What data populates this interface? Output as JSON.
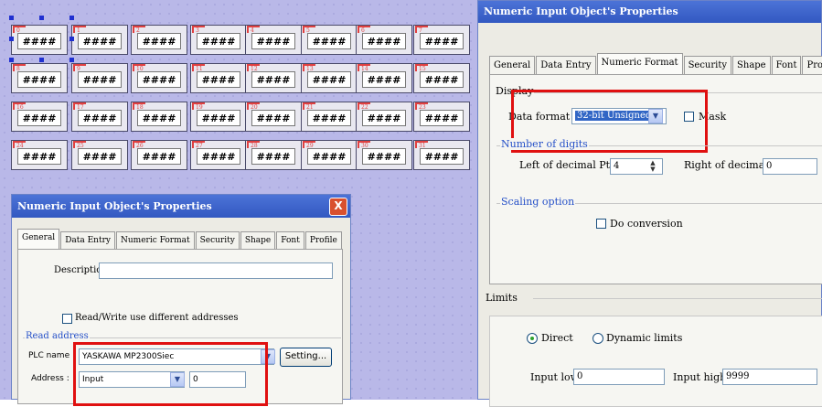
{
  "grid": {
    "placeholder": "####",
    "tags": [
      "0",
      "1",
      "2",
      "3",
      "4",
      "5",
      "6",
      "7",
      "8",
      "9",
      "10",
      "11",
      "12",
      "13",
      "14",
      "15",
      "16",
      "17",
      "18",
      "19",
      "20",
      "21",
      "22",
      "23",
      "24",
      "25",
      "26",
      "27",
      "28",
      "29",
      "30",
      "31"
    ]
  },
  "right_dialog": {
    "title": "Numeric Input Object's Properties",
    "tabs": [
      "General",
      "Data Entry",
      "Numeric Format",
      "Security",
      "Shape",
      "Font",
      "Profile"
    ],
    "active_tab": "Numeric Format",
    "display": {
      "title": "Display",
      "data_format_label": "Data format :",
      "data_format_value": "32-bit Unsigned",
      "mask_label": "Mask"
    },
    "digits": {
      "title": "Number of digits",
      "left_label": "Left of decimal Pt. :",
      "left_value": "4",
      "right_label": "Right of decimal Pt. :",
      "right_value": "0"
    },
    "scaling": {
      "title": "Scaling option",
      "conversion_label": "Do conversion"
    },
    "limits": {
      "title": "Limits",
      "direct_label": "Direct",
      "dynamic_label": "Dynamic limits",
      "low_label": "Input low :",
      "low_value": "0",
      "high_label": "Input high :",
      "high_value": "9999"
    }
  },
  "left_dialog": {
    "title": "Numeric Input Object's Properties",
    "close": "X",
    "tabs": [
      "General",
      "Data Entry",
      "Numeric Format",
      "Security",
      "Shape",
      "Font",
      "Profile"
    ],
    "active_tab": "General",
    "description_label": "Description :",
    "description_value": "",
    "rw_label": "Read/Write use different addresses",
    "read_address_title": "Read address",
    "plc_name_label": "PLC name :",
    "plc_name_value": "YASKAWA MP2300Siec",
    "setting_button": "Setting...",
    "address_label": "Address :",
    "address_type": "Input",
    "address_value": "0"
  },
  "colors": {
    "canvas": "#b9b8e8",
    "highlight": "#e01010",
    "titlebar": "#3a63cc",
    "group_title": "#2550c8"
  }
}
